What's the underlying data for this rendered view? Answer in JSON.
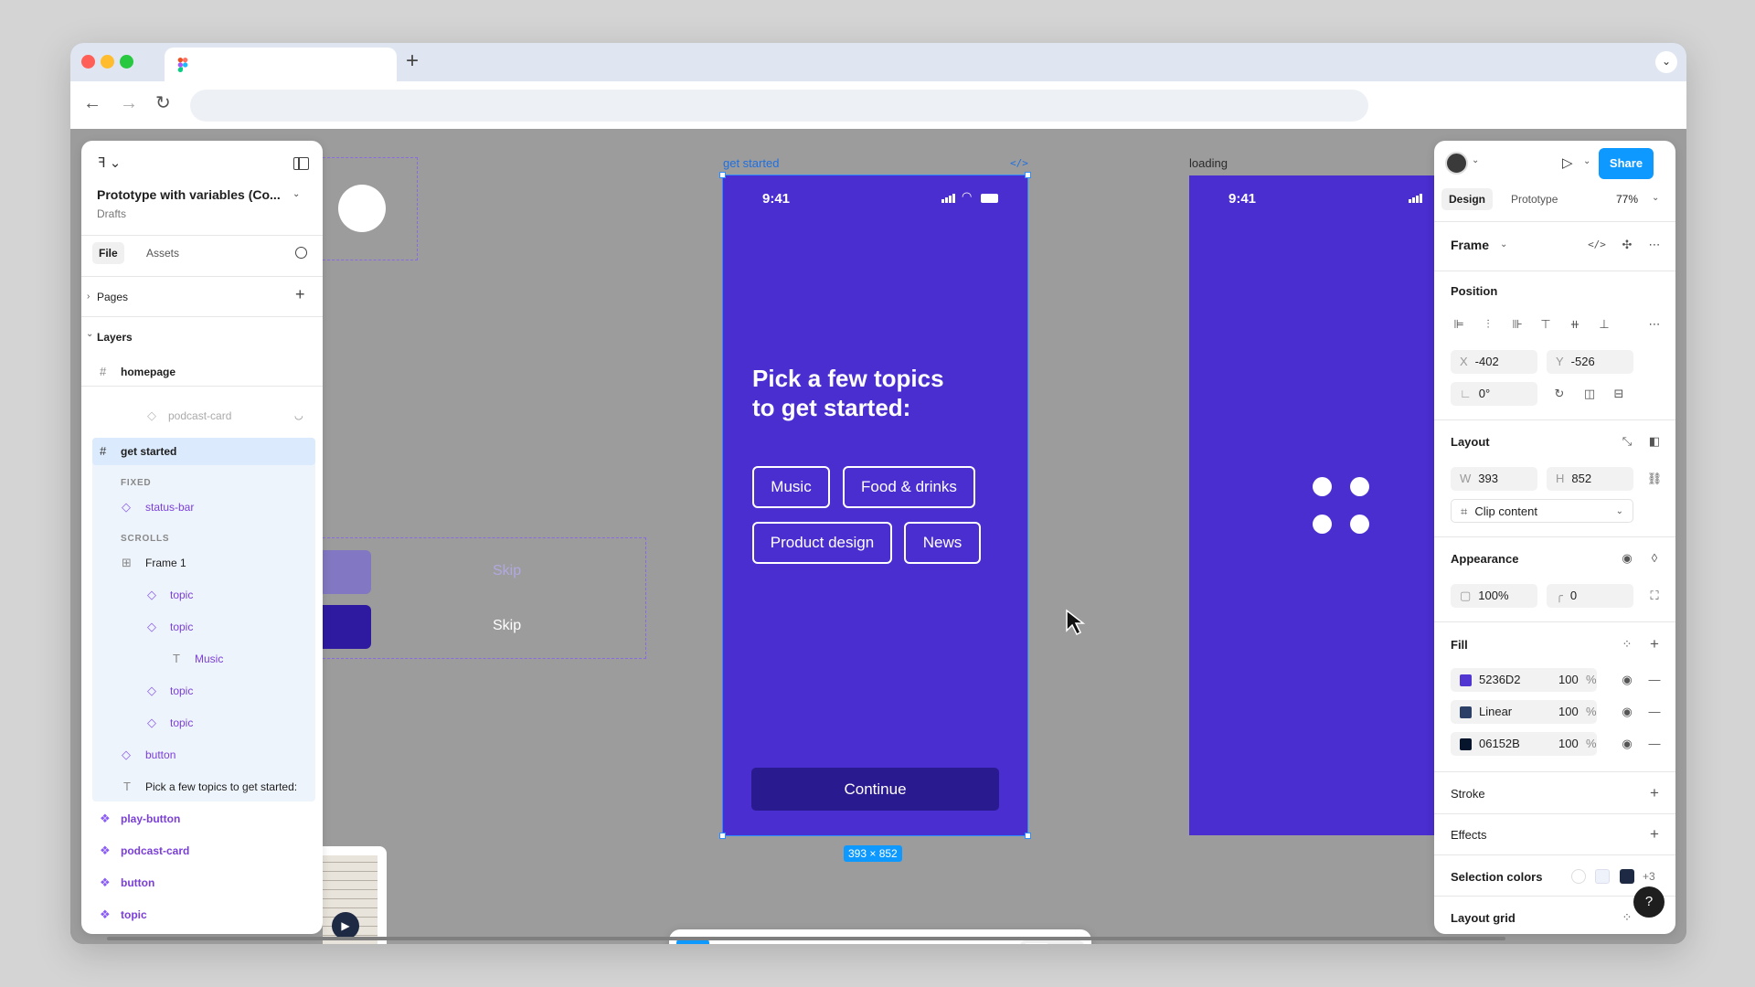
{
  "browser": {
    "new_tab": "+",
    "tab_menu": "⌄",
    "back": "←",
    "forward": "→",
    "reload": "↻",
    "address": ""
  },
  "left_panel": {
    "file_title": "Prototype with variables (Co...",
    "subtitle": "Drafts",
    "tabs": [
      "File",
      "Assets"
    ],
    "pages_label": "Pages",
    "layers_label": "Layers",
    "layers": [
      {
        "label": "homepage",
        "icon": "frame-icon",
        "glyph": "#"
      },
      {
        "label": "podcast-card",
        "icon": "instance-icon",
        "glyph": "◇"
      },
      {
        "label": "get started",
        "icon": "frame-icon",
        "glyph": "#"
      },
      {
        "label": "FIXED"
      },
      {
        "label": "status-bar",
        "icon": "instance-icon",
        "glyph": "◇"
      },
      {
        "label": "SCROLLS"
      },
      {
        "label": "Frame 1",
        "icon": "grid-icon",
        "glyph": "⊞"
      },
      {
        "label": "topic",
        "icon": "instance-icon",
        "glyph": "◇"
      },
      {
        "label": "topic",
        "icon": "instance-icon",
        "glyph": "◇"
      },
      {
        "label": "Music",
        "icon": "text-icon",
        "glyph": "T"
      },
      {
        "label": "topic",
        "icon": "instance-icon",
        "glyph": "◇"
      },
      {
        "label": "topic",
        "icon": "instance-icon",
        "glyph": "◇"
      },
      {
        "label": "button",
        "icon": "instance-icon",
        "glyph": "◇"
      },
      {
        "label": "Pick a few topics to get started:",
        "icon": "text-icon",
        "glyph": "T"
      },
      {
        "label": "play-button",
        "icon": "component-icon",
        "glyph": "❖"
      },
      {
        "label": "podcast-card",
        "icon": "component-icon",
        "glyph": "❖"
      },
      {
        "label": "button",
        "icon": "component-icon",
        "glyph": "❖"
      },
      {
        "label": "topic",
        "icon": "component-icon",
        "glyph": "❖"
      }
    ]
  },
  "canvas": {
    "get_started_label": "get started",
    "loading_label": "loading",
    "skip_1": "Skip",
    "skip_2": "Skip",
    "dimensions_badge": "393 × 852",
    "phone_main": {
      "time": "9:41",
      "heading_line1": "Pick a few topics",
      "heading_line2": "to get started:",
      "chips": [
        "Music",
        "Food & drinks",
        "Product design",
        "News"
      ],
      "continue_label": "Continue"
    },
    "phone_loading": {
      "time": "9:41"
    }
  },
  "right_panel": {
    "share_label": "Share",
    "tabs": [
      "Design",
      "Prototype"
    ],
    "zoom": "77%",
    "frame_label": "Frame",
    "position": {
      "title": "Position",
      "x_label": "X",
      "x": "-402",
      "y_label": "Y",
      "y": "-526",
      "rotation": "0°"
    },
    "layout": {
      "title": "Layout",
      "w_label": "W",
      "w": "393",
      "h_label": "H",
      "h": "852",
      "clip_label": "Clip content"
    },
    "appearance": {
      "title": "Appearance",
      "opacity": "100%",
      "radius": "0"
    },
    "fill": {
      "title": "Fill",
      "items": [
        {
          "label": "5236D2",
          "opacity": "100",
          "unit": "%",
          "color": "#5236D2"
        },
        {
          "label": "Linear",
          "opacity": "100",
          "unit": "%",
          "color": "#2c3f66"
        },
        {
          "label": "06152B",
          "opacity": "100",
          "unit": "%",
          "color": "#06152B"
        }
      ]
    },
    "stroke_title": "Stroke",
    "effects_title": "Effects",
    "selection_colors": {
      "title": "Selection colors",
      "more": "+3"
    },
    "layout_grid_title": "Layout grid",
    "help": "?"
  },
  "colors": {
    "primary": "#4a2ecf",
    "dark_button": "#2a1a8f",
    "accent_blue": "#0d99ff",
    "component_purple": "#7a3fd9"
  }
}
